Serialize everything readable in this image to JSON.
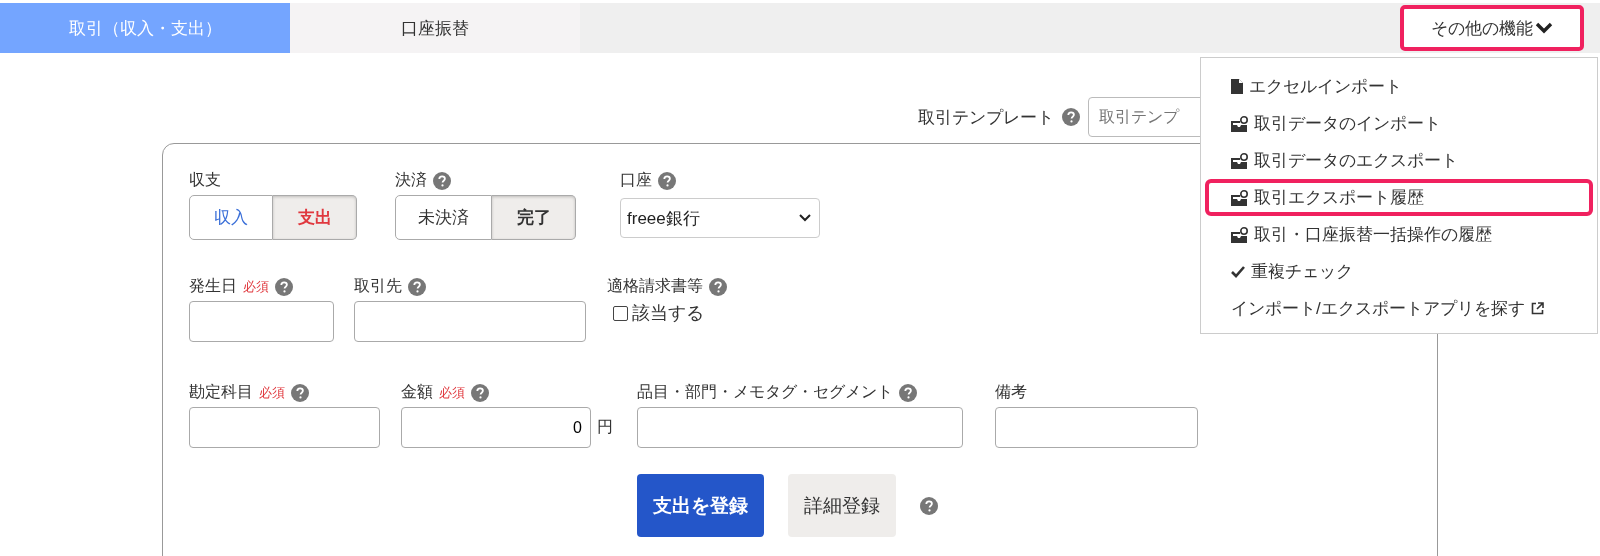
{
  "tabs": [
    {
      "label": "取引（収入・支出）",
      "selected": true
    },
    {
      "label": "口座振替",
      "selected": false
    }
  ],
  "more_button": {
    "label": "その他の機能",
    "highlighted": true
  },
  "menu": {
    "items": [
      {
        "kind": "file",
        "label": "エクセルインポート",
        "highlighted": false
      },
      {
        "kind": "inbox",
        "label": "取引データのインポート",
        "highlighted": false
      },
      {
        "kind": "inbox",
        "label": "取引データのエクスポート",
        "highlighted": false
      },
      {
        "kind": "inbox",
        "label": "取引エクスポート履歴",
        "highlighted": true
      },
      {
        "kind": "inbox",
        "label": "取引・口座振替一括操作の履歴",
        "highlighted": false
      },
      {
        "kind": "check",
        "label": "重複チェック",
        "highlighted": false
      },
      {
        "kind": "external",
        "label": "インポート/エクスポートアプリを探す",
        "highlighted": false
      }
    ]
  },
  "template": {
    "label": "取引テンプレート",
    "help": true,
    "placeholder": "取引テンプ"
  },
  "form": {
    "rows": [
      [
        {
          "kind": "toggle",
          "label": "収支",
          "help": false,
          "options": [
            {
              "label": "収入",
              "selected": false,
              "color": "#3a6fd8"
            },
            {
              "label": "支出",
              "selected": true,
              "color": "#e0383e"
            }
          ]
        },
        {
          "kind": "toggle",
          "label": "決済",
          "help": true,
          "options": [
            {
              "label": "未決済",
              "selected": false
            },
            {
              "label": "完了",
              "selected": true
            }
          ]
        },
        {
          "kind": "select",
          "label": "口座",
          "help": true,
          "value": "freee銀行"
        }
      ],
      [
        {
          "kind": "input",
          "label": "発生日",
          "required": "必須",
          "help": true
        },
        {
          "kind": "input",
          "label": "取引先",
          "help": true
        },
        {
          "kind": "checkbox",
          "label": "適格請求書等",
          "help": true,
          "option": "該当する",
          "checked": false
        }
      ],
      [
        {
          "kind": "input",
          "label": "勘定科目",
          "required": "必須",
          "help": true
        },
        {
          "kind": "amount",
          "label": "金額",
          "required": "必須",
          "help": true,
          "value": "0",
          "unit": "円"
        },
        {
          "kind": "input",
          "label": "品目・部門・メモタグ・セグメント",
          "help": true
        },
        {
          "kind": "input",
          "label": "備考",
          "help": false
        }
      ]
    ]
  },
  "buttons": [
    {
      "kind": "primary",
      "label": "支出を登録"
    },
    {
      "kind": "secondary",
      "label": "詳細登録"
    }
  ],
  "buttons_help": true
}
